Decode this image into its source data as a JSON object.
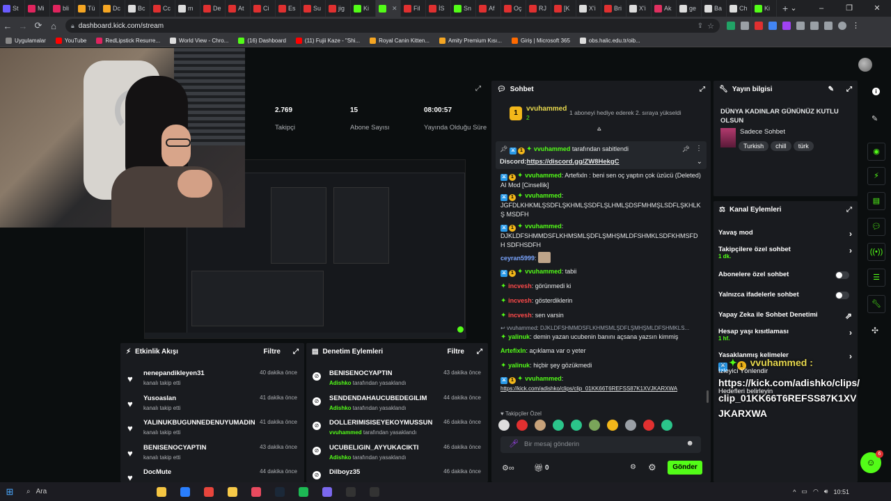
{
  "browser": {
    "tabs": [
      {
        "label": "St",
        "color": "#6a5cff"
      },
      {
        "label": "Mi",
        "color": "#e0245e"
      },
      {
        "label": "bli",
        "color": "#e0245e"
      },
      {
        "label": "Tü",
        "color": "#f5a623"
      },
      {
        "label": "Dc",
        "color": "#f5a623"
      },
      {
        "label": "Bc",
        "color": "#ddd"
      },
      {
        "label": "Cc",
        "color": "#e03030"
      },
      {
        "label": "m",
        "color": "#ddd"
      },
      {
        "label": "De",
        "color": "#e03030"
      },
      {
        "label": "At",
        "color": "#e03030"
      },
      {
        "label": "Ci",
        "color": "#e03030"
      },
      {
        "label": "Es",
        "color": "#e03030"
      },
      {
        "label": "Su",
        "color": "#e03030"
      },
      {
        "label": "jig",
        "color": "#e03030"
      },
      {
        "label": "Ki",
        "color": "#53fc18"
      },
      {
        "label": "",
        "color": "#53fc18",
        "active": true
      },
      {
        "label": "Fil",
        "color": "#e03030"
      },
      {
        "label": "İS",
        "color": "#e03030"
      },
      {
        "label": "Sn",
        "color": "#53fc18"
      },
      {
        "label": "Af",
        "color": "#e03030"
      },
      {
        "label": "Oç",
        "color": "#e03030"
      },
      {
        "label": "RJ",
        "color": "#e03030"
      },
      {
        "label": "[K",
        "color": "#e03030"
      },
      {
        "label": "X'i",
        "color": "#ddd"
      },
      {
        "label": "Bri",
        "color": "#e03030"
      },
      {
        "label": "X'i",
        "color": "#ddd"
      },
      {
        "label": "Ak",
        "color": "#e03060"
      },
      {
        "label": "ge",
        "color": "#ddd"
      },
      {
        "label": "Ba",
        "color": "#ddd"
      },
      {
        "label": "Ch",
        "color": "#ddd"
      },
      {
        "label": "Ki",
        "color": "#53fc18"
      }
    ],
    "new_tab": "+",
    "window_controls": [
      "⌄",
      "–",
      "❐",
      "✕"
    ],
    "url": "dashboard.kick.com/stream",
    "bookmarks": [
      {
        "label": "Uygulamalar",
        "color": "#888"
      },
      {
        "label": "YouTube",
        "color": "#ff0000"
      },
      {
        "label": "RedLipstick Resurre...",
        "color": "#e0245e"
      },
      {
        "label": "World View - Chro...",
        "color": "#ddd"
      },
      {
        "label": "(16) Dashboard",
        "color": "#53fc18"
      },
      {
        "label": "(11) Fujii Kaze - \"Shi...",
        "color": "#ff0000"
      },
      {
        "label": "Royal Canin Kitten...",
        "color": "#f5a623"
      },
      {
        "label": "Amity Premium Kısı...",
        "color": "#f5a623"
      },
      {
        "label": "Giriş | Microsoft 365",
        "color": "#ff6a00"
      },
      {
        "label": "obs.halic.edu.tr/oib...",
        "color": "#ddd"
      }
    ]
  },
  "stats": [
    {
      "value": "2.769",
      "label": "Takipçi"
    },
    {
      "value": "15",
      "label": "Abone Sayısı"
    },
    {
      "value": "08:00:57",
      "label": "Yayında Olduğu Süre"
    }
  ],
  "activity": {
    "title": "Etkinlik Akışı",
    "filter": "Filtre",
    "items": [
      {
        "name": "nenepandikleyen31",
        "sub": "kanalı takip etti",
        "time": "40 dakika önce"
      },
      {
        "name": "Yusoaslan",
        "sub": "kanalı takip etti",
        "time": "41 dakika önce"
      },
      {
        "name": "YALINUKBUGUNNEDENUYUMADIN",
        "sub": "kanalı takip etti",
        "time": "41 dakika önce"
      },
      {
        "name": "BENISENOCYAPTIN",
        "sub": "kanalı takip etti",
        "time": "43 dakika önce"
      },
      {
        "name": "DocMute",
        "sub": "",
        "time": "44 dakika önce"
      }
    ]
  },
  "moderation": {
    "title": "Denetim Eylemleri",
    "filter": "Filtre",
    "items": [
      {
        "name": "BENISENOCYAPTIN",
        "by": "Adishko",
        "sub": "tarafından yasaklandı",
        "time": "43 dakika önce"
      },
      {
        "name": "SENDENDAHAUCUBEDEGILIM",
        "by": "Adishko",
        "sub": "tarafından yasaklandı",
        "time": "44 dakika önce"
      },
      {
        "name": "DOLLERIMISISEYEKOYMUSSUN",
        "by": "vvuhammed",
        "sub": "tarafından yasaklandı",
        "time": "46 dakika önce"
      },
      {
        "name": "UCUBELIGIN_AYYUKACIKTI",
        "by": "Adishko",
        "sub": "tarafından yasaklandı",
        "time": "46 dakika önce"
      },
      {
        "name": "Dilboyz35",
        "by": "",
        "sub": "",
        "time": "46 dakika önce"
      }
    ]
  },
  "chat": {
    "title": "Sohbet",
    "gifter": {
      "name": "vvuhammed",
      "count": "2",
      "text": "1 aboneyi hediye ederek 2. sıraya yükseldi"
    },
    "pinned": {
      "by": "vvuhammed",
      "by_suffix": "tarafından sabitlendi",
      "label": "Discord:",
      "link": "https://discord.gg/ZW8HekgC"
    },
    "messages": [
      {
        "user": "vvuhammed",
        "cls": "user-g",
        "badges": true,
        "text": "Artefixln : beni sen oç yaptın çok üzücü (Deleted) AI Mod [Cinsellik]",
        "inline": true
      },
      {
        "user": "vvuhammed",
        "cls": "user-g",
        "badges": true,
        "text": "JGFDLKHKMLŞSDFLŞKHMLŞSDFLŞLHMLŞDSFMHMŞLSDFLŞKHLKŞ MSDFH",
        "inline": false
      },
      {
        "user": "vvuhammed",
        "cls": "user-g",
        "badges": true,
        "text": "DJKLDFSHMMDSFLKHMSMLŞDFLŞMHŞMLDFSHMKLSDFKHMSFDH SDFHSDFH",
        "inline": false
      },
      {
        "user": "ceyran5999",
        "cls": "user-b",
        "badges": false,
        "text": "",
        "inline": true
      },
      {
        "user": "vvuhammed",
        "cls": "user-g",
        "badges": true,
        "text": "tabii",
        "inline": true
      },
      {
        "user": "incvesh",
        "cls": "user-r",
        "badges": false,
        "text": "görünmedi ki",
        "inline": true
      },
      {
        "user": "incvesh",
        "cls": "user-r",
        "badges": false,
        "text": "gösterdiklerin",
        "inline": true
      },
      {
        "user": "incvesh",
        "cls": "user-r",
        "badges": false,
        "text": "sen varsin",
        "inline": true
      },
      {
        "user": "vvuhammed",
        "cls": "muted",
        "badges": false,
        "text": "DJKLDFSHMMDSFLKHMSMLŞDFLŞMHŞMLDFSHMKLS...",
        "inline": true
      },
      {
        "user": "yalinuk",
        "cls": "user-g",
        "badges": false,
        "text": "demin yazan ucubenin banını açsana yazsın kimmiş",
        "inline": true
      },
      {
        "user": "ArtefixIn",
        "cls": "user-g",
        "badges": false,
        "text": "açıklama var o yeter",
        "inline": true
      },
      {
        "user": "yalinuk",
        "cls": "user-g",
        "badges": false,
        "text": "hiçbir şey gözükmedi",
        "inline": true
      },
      {
        "user": "vvuhammed",
        "cls": "user-g",
        "badges": true,
        "text": "https://kick.com/adishko/clips/clip_01KK66T6REFSS87K1XVJKARXWA",
        "inline": false
      }
    ],
    "follower_emotes_label": "Takipçiler Özel",
    "input_placeholder": "Bir mesaj gönderin",
    "points": "0",
    "send": "Gönder"
  },
  "stream_info": {
    "title": "Yayın bilgisi",
    "stream_title": "DÜNYA KADINLAR GÜNÜNÜZ KUTLU OLSUN",
    "category": "Sadece Sohbet",
    "tags": [
      "Turkish",
      "chill",
      "türk"
    ]
  },
  "channel_actions": {
    "title": "Kanal Eylemleri",
    "items": [
      {
        "label": "Yavaş mod",
        "sub": "",
        "control": "chevron"
      },
      {
        "label": "Takipçilere özel sohbet",
        "sub": "1 dk.",
        "control": "chevron"
      },
      {
        "label": "Abonelere özel sohbet",
        "sub": "",
        "control": "toggle"
      },
      {
        "label": "Yalnızca ifadelerle sohbet",
        "sub": "",
        "control": "toggle"
      },
      {
        "label": "Yapay Zeka ile Sohbet Denetimi",
        "sub": "",
        "control": "external"
      },
      {
        "label": "Hesap yaşı kısıtlaması",
        "sub": "1 hf.",
        "control": "chevron"
      },
      {
        "label": "Yasaklanmış kelimeler",
        "sub": "",
        "control": "chevron"
      }
    ]
  },
  "overlay": {
    "user": "vvuhammed :",
    "line_a": "İzleyici Yönlendir",
    "line_b": "Hedefleri belirleyin",
    "text": "https://kick.com/adishko/clips/clip_01KK66T6REFSS87K1XVJKARXWA"
  },
  "fab_badge": "6",
  "taskbar": {
    "search": "Ara",
    "clock": "10:51",
    "apps": [
      "#f5c542",
      "#2a7fff",
      "#e8453c",
      "#f7c948",
      "#e84a5f",
      "#1b2838",
      "#1db954",
      "#7b68ee",
      "#333",
      "#333"
    ]
  }
}
